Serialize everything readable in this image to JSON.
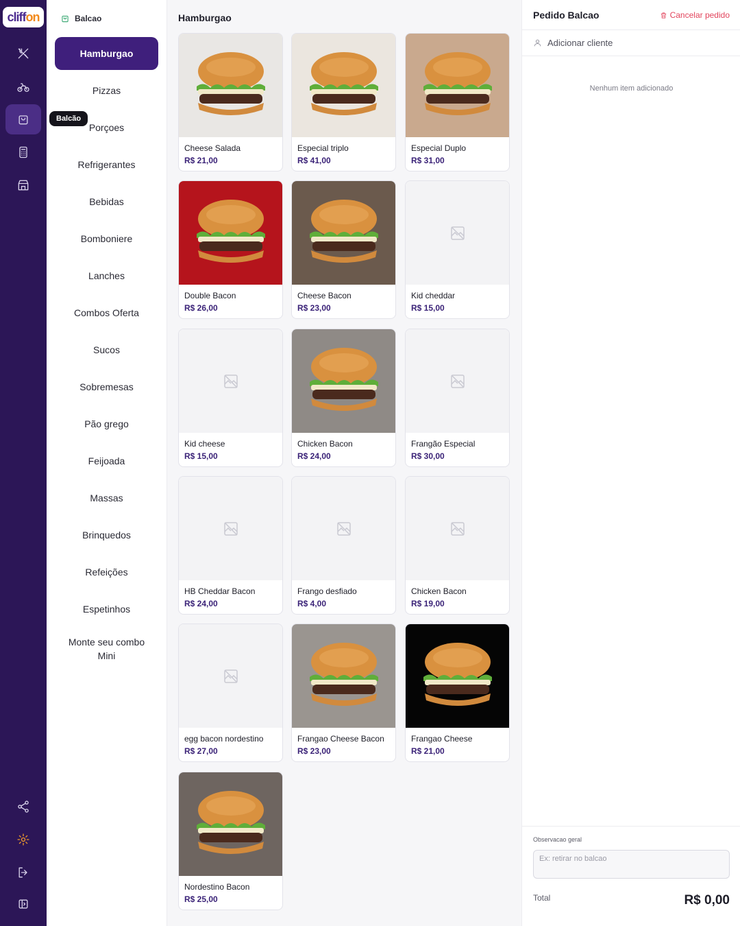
{
  "brand": {
    "logo_part1": "cliff",
    "logo_part2": "on"
  },
  "rail": {
    "items": [
      {
        "name": "utensils-icon"
      },
      {
        "name": "delivery-bike-icon"
      },
      {
        "name": "shopping-bag-icon",
        "active": true,
        "tooltip": "Balcão"
      },
      {
        "name": "calculator-icon"
      },
      {
        "name": "store-icon"
      },
      {
        "name": "share-icon"
      },
      {
        "name": "gear-icon"
      },
      {
        "name": "logout-icon"
      },
      {
        "name": "sidebar-toggle-icon"
      }
    ],
    "tooltip": "Balcão"
  },
  "categories": {
    "header": "Balcao",
    "items": [
      {
        "label": "Hamburgao",
        "active": true
      },
      {
        "label": "Pizzas"
      },
      {
        "label": "Porçoes"
      },
      {
        "label": "Refrigerantes"
      },
      {
        "label": "Bebidas"
      },
      {
        "label": "Bomboniere"
      },
      {
        "label": "Lanches"
      },
      {
        "label": "Combos Oferta"
      },
      {
        "label": "Sucos"
      },
      {
        "label": "Sobremesas"
      },
      {
        "label": "Pão grego"
      },
      {
        "label": "Feijoada"
      },
      {
        "label": "Massas"
      },
      {
        "label": "Brinquedos"
      },
      {
        "label": "Refeições"
      },
      {
        "label": "Espetinhos"
      },
      {
        "label": "Monte seu combo Mini"
      }
    ]
  },
  "products": {
    "title": "Hamburgao",
    "items": [
      {
        "name": "Cheese Salada",
        "price": "R$ 21,00",
        "image": "burger-photo",
        "bg": "#e9e7e4"
      },
      {
        "name": "Especial triplo",
        "price": "R$ 41,00",
        "image": "burger-photo",
        "bg": "#ebe6df"
      },
      {
        "name": "Especial Duplo",
        "price": "R$ 31,00",
        "image": "burger-photo",
        "bg": "#c9a98e"
      },
      {
        "name": "Double Bacon",
        "price": "R$ 26,00",
        "image": "burger-photo",
        "bg": "#b5141c"
      },
      {
        "name": "Cheese Bacon",
        "price": "R$ 23,00",
        "image": "burger-photo",
        "bg": "#6b5a4d"
      },
      {
        "name": "Kid cheddar",
        "price": "R$ 15,00",
        "image": "placeholder"
      },
      {
        "name": "Kid cheese",
        "price": "R$ 15,00",
        "image": "placeholder"
      },
      {
        "name": "Chicken Bacon",
        "price": "R$ 24,00",
        "image": "burger-photo",
        "bg": "#8f8a86"
      },
      {
        "name": "Frangão Especial",
        "price": "R$ 30,00",
        "image": "placeholder"
      },
      {
        "name": "HB Cheddar Bacon",
        "price": "R$ 24,00",
        "image": "placeholder"
      },
      {
        "name": "Frango desfiado",
        "price": "R$ 4,00",
        "image": "placeholder"
      },
      {
        "name": "Chicken Bacon",
        "price": "R$ 19,00",
        "image": "placeholder"
      },
      {
        "name": "egg bacon nordestino",
        "price": "R$ 27,00",
        "image": "placeholder"
      },
      {
        "name": "Frangao Cheese Bacon",
        "price": "R$ 23,00",
        "image": "burger-photo",
        "bg": "#9a9590"
      },
      {
        "name": "Frangao Cheese",
        "price": "R$ 21,00",
        "image": "burger-photo",
        "bg": "#050505"
      },
      {
        "name": "Nordestino Bacon",
        "price": "R$ 25,00",
        "image": "burger-photo",
        "bg": "#6e6560"
      }
    ]
  },
  "order": {
    "title": "Pedido Balcao",
    "cancel_label": "Cancelar pedido",
    "add_client_label": "Adicionar cliente",
    "empty_label": "Nenhum item adicionado",
    "obs_label": "Observacao geral",
    "obs_placeholder": "Ex: retirar no balcao",
    "total_label": "Total",
    "total_value": "R$ 0,00"
  },
  "colors": {
    "rail_bg": "#2c1657",
    "accent": "#3f1f7c",
    "price": "#3b2378",
    "danger": "#e2445c",
    "settings": "#f29b2b"
  }
}
